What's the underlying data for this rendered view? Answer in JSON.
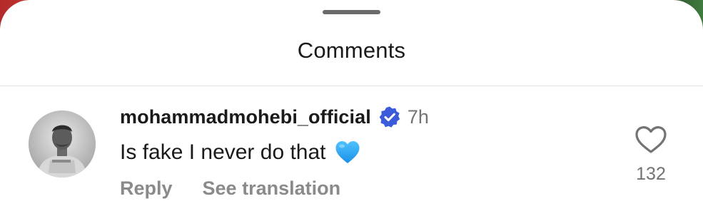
{
  "sheet": {
    "title": "Comments"
  },
  "comment": {
    "username": "mohammadmohebi_official",
    "verified_icon": "verified-badge-icon",
    "time": "7h",
    "text": "Is fake I never do that",
    "emoji": "blue-heart-emoji",
    "actions": {
      "reply": "Reply",
      "see_translation": "See translation"
    },
    "likes": {
      "icon": "heart-outline-icon",
      "count": "132"
    }
  },
  "colors": {
    "verified_blue": "#3b5bdb",
    "heart_blue": "#1ea1f2",
    "muted_text": "#737373",
    "primary_text": "#1a1a1a"
  }
}
